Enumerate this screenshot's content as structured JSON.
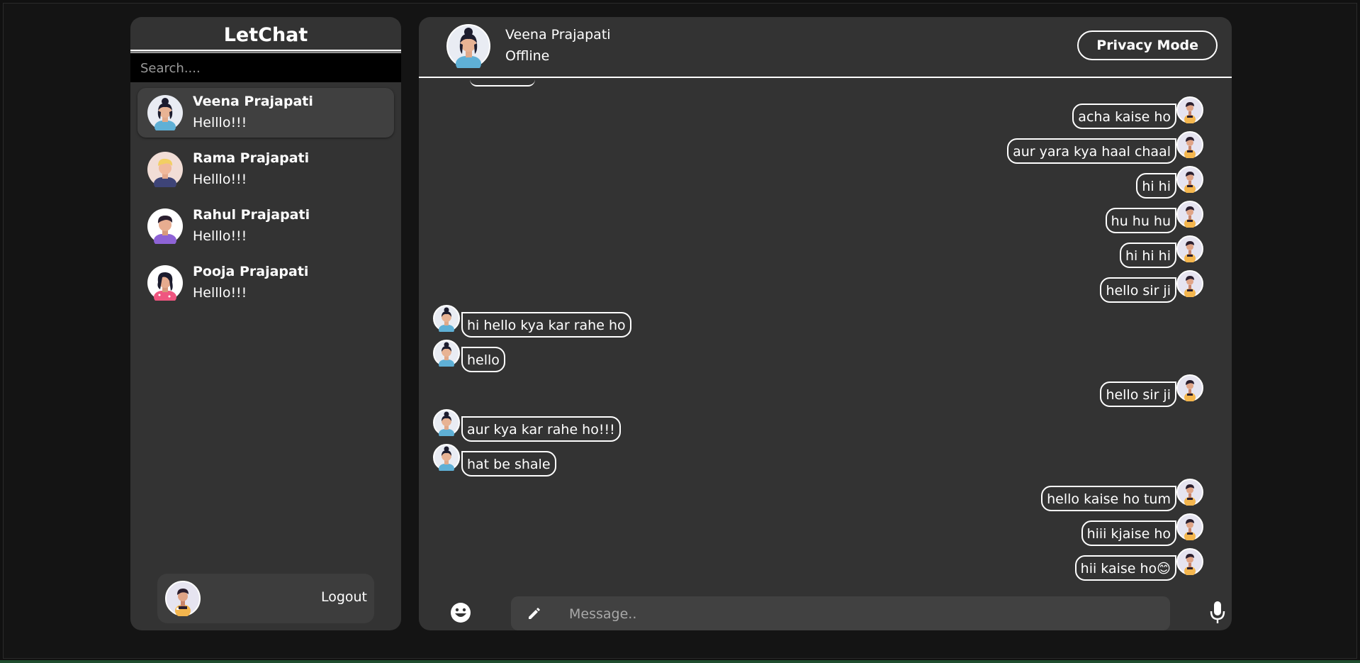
{
  "app": {
    "title": "LetChat",
    "colors": {
      "page_bg": "#111111",
      "panel_bg": "#333333",
      "active_item_bg": "#404040",
      "search_bg": "#000000",
      "input_bg": "#414141",
      "text": "#ffffff"
    }
  },
  "search": {
    "placeholder": "Search...."
  },
  "contacts": [
    {
      "name": "Veena Prajapati",
      "last_message": "Helllo!!!",
      "avatar": "woman-bun-avatar-icon",
      "active": true
    },
    {
      "name": "Rama Prajapati",
      "last_message": "Helllo!!!",
      "avatar": "man-blond-avatar-icon",
      "active": false
    },
    {
      "name": "Rahul Prajapati",
      "last_message": "Helllo!!!",
      "avatar": "man-purple-shirt-avatar-icon",
      "active": false
    },
    {
      "name": "Pooja Prajapati",
      "last_message": "Helllo!!!",
      "avatar": "woman-pink-shirt-avatar-icon",
      "active": false
    }
  ],
  "current_user": {
    "avatar": "current-user-avatar-icon",
    "logout_label": "Logout"
  },
  "chat": {
    "contact_name": "Veena Prajapati",
    "status": "Offline",
    "privacy_label": "Privacy Mode",
    "messages": [
      {
        "from": "me",
        "text": "acha kaise ho"
      },
      {
        "from": "me",
        "text": "aur yara kya haal chaal"
      },
      {
        "from": "me",
        "text": "hi hi"
      },
      {
        "from": "me",
        "text": "hu hu hu"
      },
      {
        "from": "me",
        "text": "hi hi hi"
      },
      {
        "from": "me",
        "text": "hello sir ji"
      },
      {
        "from": "them",
        "text": "hi hello kya kar rahe ho"
      },
      {
        "from": "them",
        "text": "hello"
      },
      {
        "from": "me",
        "text": "hello sir ji"
      },
      {
        "from": "them",
        "text": "aur kya kar rahe ho!!!"
      },
      {
        "from": "them",
        "text": "hat be shale"
      },
      {
        "from": "me",
        "text": "hello kaise ho tum"
      },
      {
        "from": "me",
        "text": "hiii kjaise ho"
      },
      {
        "from": "me",
        "text": "hii kaise ho😊"
      }
    ]
  },
  "composer": {
    "placeholder": "Message..",
    "emoji_icon": "emoji-smile-icon",
    "pencil_icon": "pencil-icon",
    "mic_icon": "microphone-icon"
  }
}
